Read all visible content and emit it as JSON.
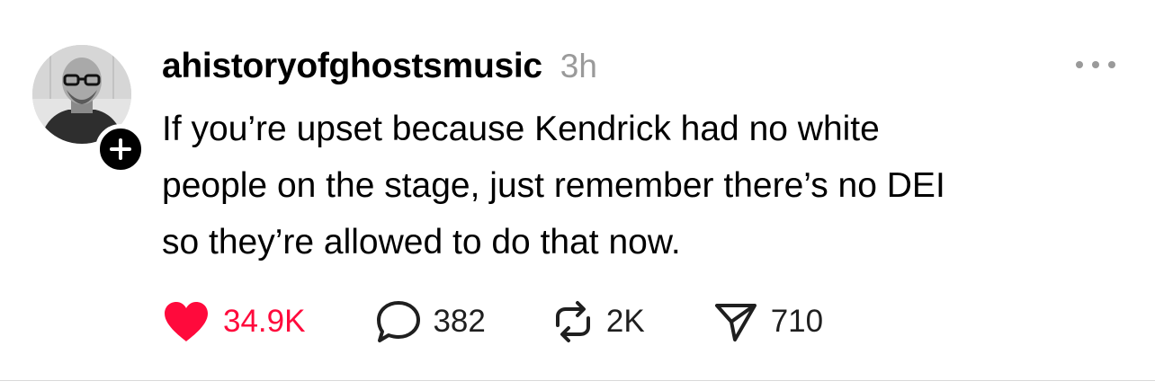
{
  "post": {
    "username": "ahistoryofghostsmusic",
    "timestamp": "3h",
    "body_lines": [
      "If you’re upset because Kendrick had no white",
      "people on the stage, just remember there’s no DEI",
      "so they’re allowed to do that now."
    ],
    "avatar_icon": "profile-photo",
    "follow_icon": "plus-icon",
    "more_icon": "more-horizontal-icon"
  },
  "actions": {
    "like": {
      "icon": "heart-icon",
      "count": "34.9K",
      "liked": true
    },
    "reply": {
      "icon": "comment-icon",
      "count": "382"
    },
    "repost": {
      "icon": "repost-icon",
      "count": "2K"
    },
    "share": {
      "icon": "send-icon",
      "count": "710"
    }
  },
  "colors": {
    "like_active": "#ff0a3c",
    "text_primary": "#000000",
    "text_secondary": "#9a9a9a",
    "icon": "#1f1f1f"
  }
}
